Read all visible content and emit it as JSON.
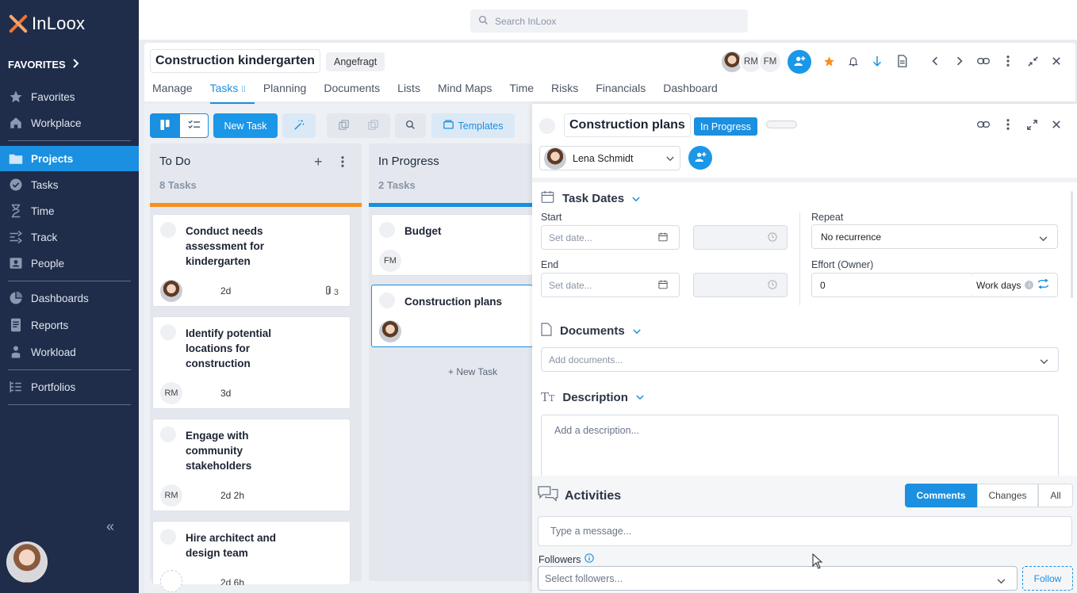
{
  "app": {
    "logo_text": "InLoox"
  },
  "sidebar": {
    "favorites_label": "FAVORITES",
    "items": [
      {
        "label": "Favorites",
        "icon": "star-icon"
      },
      {
        "label": "Workplace",
        "icon": "home-icon"
      },
      {
        "label": "Projects",
        "icon": "folder-icon",
        "active": true
      },
      {
        "label": "Tasks",
        "icon": "check-circle-icon"
      },
      {
        "label": "Time",
        "icon": "hourglass-icon"
      },
      {
        "label": "Track",
        "icon": "track-icon"
      },
      {
        "label": "People",
        "icon": "person-card-icon"
      },
      {
        "label": "Dashboards",
        "icon": "pie-icon"
      },
      {
        "label": "Reports",
        "icon": "report-icon"
      },
      {
        "label": "Workload",
        "icon": "workload-icon"
      },
      {
        "label": "Portfolios",
        "icon": "portfolio-icon"
      }
    ]
  },
  "search": {
    "placeholder": "Search InLoox"
  },
  "project": {
    "title": "Construction kindergarten",
    "status": "Angefragt",
    "members": [
      "RM",
      "FM"
    ],
    "tabs": [
      "Manage",
      "Tasks",
      "Planning",
      "Documents",
      "Lists",
      "Mind Maps",
      "Time",
      "Risks",
      "Financials",
      "Dashboard"
    ],
    "active_tab": "Tasks"
  },
  "board": {
    "new_task_label": "New Task",
    "templates_label": "Templates",
    "columns": [
      {
        "title": "To Do",
        "count": "8",
        "count_label": "Tasks",
        "accent": "#f7901e",
        "cards": [
          {
            "title": "Conduct needs assessment for kindergarten",
            "assignee": "photo",
            "duration": "2d",
            "attachments": "3"
          },
          {
            "title": "Identify potential locations for construction",
            "assignee": "RM",
            "duration": "3d"
          },
          {
            "title": "Engage with community stakeholders",
            "assignee": "RM",
            "duration": "2d 2h"
          },
          {
            "title": "Hire architect and design team",
            "assignee": "",
            "duration": "2d 6h"
          }
        ]
      },
      {
        "title": "In Progress",
        "count": "2",
        "count_label": "Tasks",
        "accent": "#1b8fe0",
        "cards": [
          {
            "title": "Budget",
            "assignee": "FM"
          },
          {
            "title": "Construction plans",
            "assignee": "photo"
          }
        ],
        "new_task_link": "+ New Task"
      }
    ]
  },
  "detail": {
    "title": "Construction plans",
    "status": "In Progress",
    "owner": "Lena Schmidt",
    "task_dates": {
      "heading": "Task Dates",
      "start_label": "Start",
      "end_label": "End",
      "date_placeholder": "Set date...",
      "repeat_label": "Repeat",
      "repeat_value": "No recurrence",
      "effort_label": "Effort (Owner)",
      "effort_value": "0",
      "effort_unit": "Work days"
    },
    "documents": {
      "heading": "Documents",
      "placeholder": "Add documents..."
    },
    "description": {
      "heading": "Description",
      "placeholder": "Add a description..."
    }
  },
  "activities": {
    "heading": "Activities",
    "tabs": [
      "Comments",
      "Changes",
      "All"
    ],
    "active_tab": "Comments",
    "message_placeholder": "Type a message...",
    "followers_label": "Followers",
    "followers_placeholder": "Select followers...",
    "follow_button": "Follow"
  }
}
